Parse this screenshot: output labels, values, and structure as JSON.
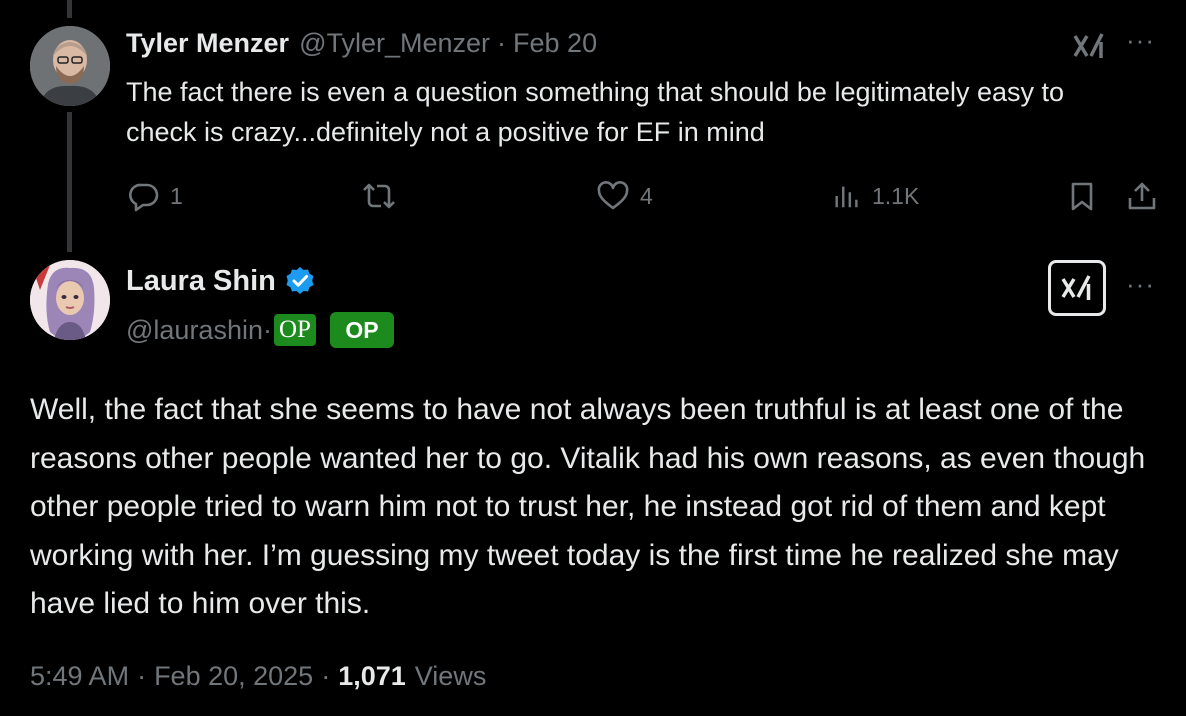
{
  "reply": {
    "author_name": "Tyler Menzer",
    "handle": "@Tyler_Menzer",
    "separator": "·",
    "date": "Feb 20",
    "text": "The fact there is even a question something that should be legitimately easy to check is crazy...definitely not a positive for EF in mind",
    "more_label": "···",
    "actions": {
      "replies": "1",
      "reposts": "",
      "likes": "4",
      "views": "1.1K"
    }
  },
  "main": {
    "author_name": "Laura Shin",
    "handle": "@laurashin",
    "separator": "·",
    "badge_op_1": "OP",
    "badge_op_2": "OP",
    "more_label": "···",
    "text": "Well, the fact that she seems to have not always been truthful is at least one of the reasons other people wanted her to go. Vitalik had his own reasons, as even though other people tried to warn him not to trust her, he instead got rid of them and kept working with her. I’m guessing my tweet today is the first time he realized she may have lied to him over this.",
    "time": "5:49 AM",
    "date": "Feb 20, 2025",
    "meta_sep": "·",
    "views_count": "1,071",
    "views_label": "Views"
  },
  "icons": {
    "reply": "reply-icon",
    "repost": "repost-icon",
    "like": "heart-icon",
    "views": "views-bar-icon",
    "bookmark": "bookmark-icon",
    "share": "share-icon",
    "grok": "grok-icon",
    "verified": "verified-badge-icon"
  },
  "colors": {
    "background": "#000000",
    "text": "#e7e9ea",
    "muted": "#71767b",
    "verified": "#1d9bf0",
    "op_badge": "#1c8a1c",
    "thread_line": "#333639"
  }
}
